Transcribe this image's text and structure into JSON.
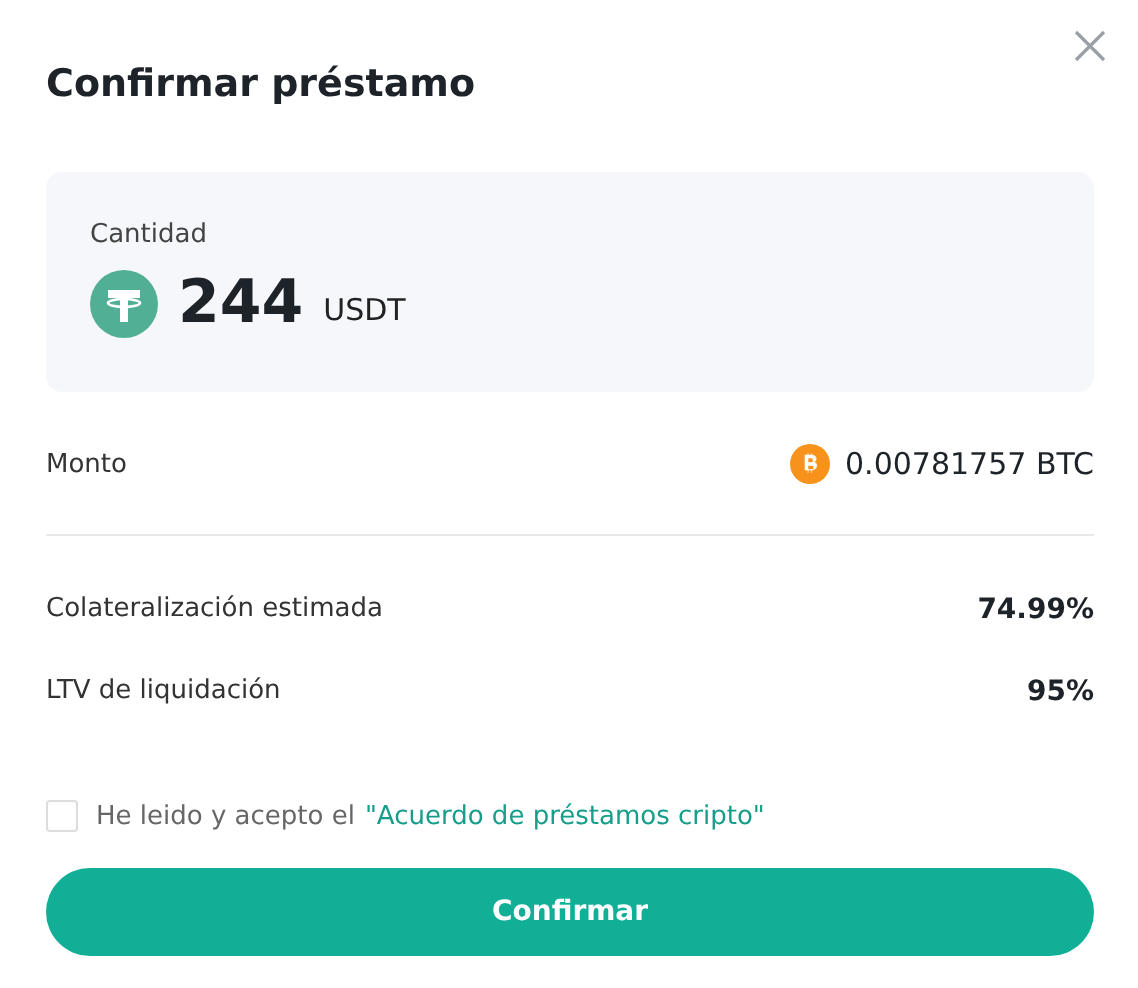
{
  "dialog": {
    "title": "Confirmar préstamo"
  },
  "amount_card": {
    "label": "Cantidad",
    "value": "244",
    "currency": "USDT"
  },
  "amount_row": {
    "label": "Monto",
    "value": "0.00781757 BTC"
  },
  "details": [
    {
      "label": "Colateralización estimada",
      "value": "74.99%"
    },
    {
      "label": "LTV de liquidación",
      "value": "95%"
    }
  ],
  "agreement": {
    "checked": false,
    "text": "He leido y acepto el",
    "link": "\"Acuerdo de préstamos cripto\""
  },
  "confirm_button": {
    "label": "Confirmar"
  }
}
